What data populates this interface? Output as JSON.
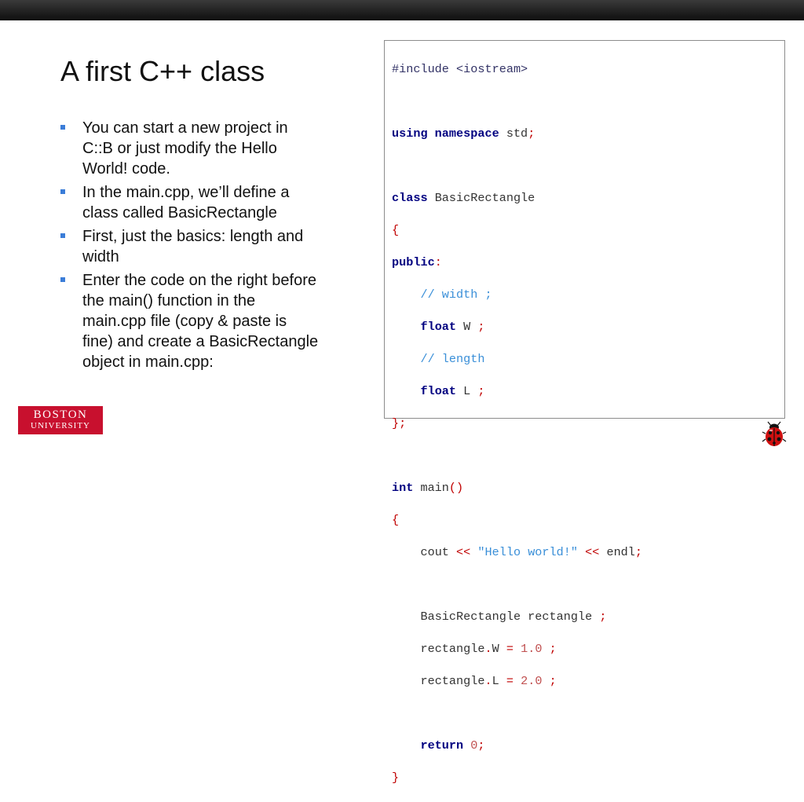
{
  "title": "A first C++ class",
  "bullets": [
    "You can start a new project in C::B or just modify the Hello World! code.",
    "In the main.cpp, we’ll define a class called BasicRectangle",
    "First, just the basics: length and width",
    "Enter the code on the right before the main() function in the main.cpp file (copy & paste is fine) and create a BasicRectangle object in main.cpp:"
  ],
  "code": {
    "include": "#include <iostream>",
    "using_kw": "using namespace",
    "using_id": " std",
    "class_kw": "class",
    "class_name": " BasicRectangle",
    "open_brace": "{",
    "public_kw": "public",
    "colon": ":",
    "comment_width": "// width ;",
    "float_kw": "float",
    "w_name": " W ",
    "semicolon": ";",
    "comment_length": "// length",
    "l_name": " L ",
    "close_brace_semi": "};",
    "int_kw": "int",
    "main_name": " main",
    "parens": "()",
    "cout": "cout ",
    "shift": "<<",
    "hello_str": " \"Hello world!\" ",
    "endl": " endl",
    "rect_decl": "BasicRectangle rectangle ",
    "rect_w_a": "rectangle",
    "dot": ".",
    "w_member": "W ",
    "eq": "=",
    "val_1": " 1.0 ",
    "rect_l_member": "L ",
    "val_2": " 2.0 ",
    "return_kw": "return",
    "zero": " 0",
    "close_brace": "}"
  },
  "logo": {
    "line1": "BOSTON",
    "line2": "UNIVERSITY"
  },
  "colors": {
    "accent_bullet": "#3b7dd8",
    "keyword": "#000080",
    "symbol": "#c00000",
    "comment": "#3a8fd8",
    "logo_red": "#c8102e"
  },
  "icons": [
    "ladybug-icon",
    "bullet-square-icon"
  ]
}
